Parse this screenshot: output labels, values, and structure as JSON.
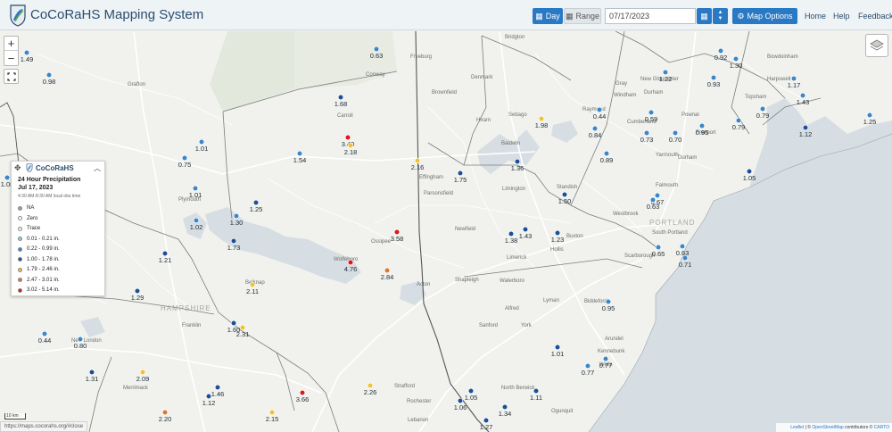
{
  "header": {
    "title": "CoCoRaHS Mapping System",
    "day_label": "Day",
    "range_label": "Range",
    "date_value": "07/17/2023",
    "map_options_label": "Map Options",
    "nav": [
      "Home",
      "Help",
      "Feedback"
    ]
  },
  "legend": {
    "brand": "CoCoRaHS",
    "title": "24 Hour Precipitation",
    "date": "Jul 17, 2023",
    "time_note": "4:30 AM-8:30 AM local obs time",
    "items": [
      {
        "label": "NA",
        "color": "#9aa0a6"
      },
      {
        "label": "Zero",
        "color": "#ffffff"
      },
      {
        "label": "Trace",
        "color": "#f5f5f5"
      },
      {
        "label": "0.01 - 0.21 in.",
        "color": "#8ecae6"
      },
      {
        "label": "0.22 - 0.99 in.",
        "color": "#3a86c8"
      },
      {
        "label": "1.00 - 1.78 in.",
        "color": "#1c4f96"
      },
      {
        "label": "1.79 - 2.46 in.",
        "color": "#f2c12e"
      },
      {
        "label": "2.47 - 3.01 in.",
        "color": "#e0762a"
      },
      {
        "label": "3.02 - 5.14 in.",
        "color": "#d7191c"
      }
    ]
  },
  "scale": "10 km",
  "url": "https://maps.cocorahs.org/#close",
  "attribution": {
    "leaflet": "Leaflet",
    "osm": "OpenStreetMap",
    "contrib": "contributors",
    "carto": "CARTO"
  },
  "state_labels": [
    "HAMPSHIRE",
    "PORTLAND"
  ],
  "places": [
    "Grafton",
    "Plymouth",
    "Carroll",
    "Conway",
    "Fryeburg",
    "Bridgton",
    "Denmark",
    "Brownfield",
    "Hiram",
    "Sebago",
    "Baldwin",
    "Limington",
    "Standish",
    "Windham",
    "Raymond",
    "Cumberland",
    "Yarmouth",
    "Falmouth",
    "Freeport",
    "New Gloucester",
    "Durham",
    "Pownal",
    "Gray",
    "Westbrook",
    "Scarborough",
    "Buxton",
    "Hollis",
    "Waterboro",
    "Newfield",
    "Parsonsfield",
    "Effingham",
    "Ossipee",
    "Wolfeboro",
    "Belknap",
    "Franklin",
    "Merrimack",
    "New London",
    "Acton",
    "Shapleigh",
    "Sanford",
    "Alfred",
    "Lyman",
    "York",
    "Biddeford",
    "Kennebunk",
    "Wells",
    "North Berwick",
    "Rochester",
    "Strafford",
    "Ogunquit",
    "Arundel",
    "Lebanon",
    "Harpswell",
    "Bowdoinham",
    "Topsham",
    "South Portland",
    "Durham",
    "Limerick"
  ],
  "stations": [
    {
      "v": "1.49",
      "c": "1"
    },
    {
      "v": "0.98",
      "c": "1"
    },
    {
      "v": "0.63",
      "c": "1"
    },
    {
      "v": "0.92",
      "c": "1"
    },
    {
      "v": "1.30",
      "c": "1"
    },
    {
      "v": "0.93",
      "c": "1"
    },
    {
      "v": "1.22",
      "c": "1"
    },
    {
      "v": "1.17",
      "c": "1"
    },
    {
      "v": "1.43",
      "c": "1"
    },
    {
      "v": "1.25",
      "c": "1"
    },
    {
      "v": "1.68",
      "c": "2"
    },
    {
      "v": "0.44",
      "c": "1"
    },
    {
      "v": "0.59",
      "c": "1"
    },
    {
      "v": "0.79",
      "c": "1"
    },
    {
      "v": "0.95",
      "c": "1"
    },
    {
      "v": "0.79",
      "c": "1"
    },
    {
      "v": "1.12",
      "c": "2"
    },
    {
      "v": "1.98",
      "c": "3"
    },
    {
      "v": "0.84",
      "c": "1"
    },
    {
      "v": "0.73",
      "c": "1"
    },
    {
      "v": "0.70",
      "c": "1"
    },
    {
      "v": "1.01",
      "c": "1"
    },
    {
      "v": "3.40",
      "c": "5"
    },
    {
      "v": "2.18",
      "c": "3"
    },
    {
      "v": "1.54",
      "c": "1"
    },
    {
      "v": "2.16",
      "c": "3"
    },
    {
      "v": "1.36",
      "c": "2"
    },
    {
      "v": "0.89",
      "c": "1"
    },
    {
      "v": "0.75",
      "c": "1"
    },
    {
      "v": "1.75",
      "c": "2"
    },
    {
      "v": "1.05",
      "c": "2"
    },
    {
      "v": "1.01",
      "c": "1"
    },
    {
      "v": "1.50",
      "c": "2"
    },
    {
      "v": "0.67",
      "c": "1"
    },
    {
      "v": "0.63",
      "c": "1"
    },
    {
      "v": "1.25",
      "c": "2"
    },
    {
      "v": "1.30",
      "c": "1"
    },
    {
      "v": "1.02",
      "c": "1"
    },
    {
      "v": "3.58",
      "c": "5"
    },
    {
      "v": "1.43",
      "c": "2"
    },
    {
      "v": "1.38",
      "c": "2"
    },
    {
      "v": "1.23",
      "c": "2"
    },
    {
      "v": "1.73",
      "c": "2"
    },
    {
      "v": "0.65",
      "c": "1"
    },
    {
      "v": "0.63",
      "c": "1"
    },
    {
      "v": "1.21",
      "c": "2"
    },
    {
      "v": "4.76",
      "c": "5"
    },
    {
      "v": "2.84",
      "c": "4"
    },
    {
      "v": "0.71",
      "c": "1"
    },
    {
      "v": "2.11",
      "c": "3"
    },
    {
      "v": "1.29",
      "c": "2"
    },
    {
      "v": "0.95",
      "c": "1"
    },
    {
      "v": "1.60",
      "c": "2"
    },
    {
      "v": "2.31",
      "c": "3"
    },
    {
      "v": "0.44",
      "c": "1"
    },
    {
      "v": "0.80",
      "c": "1"
    },
    {
      "v": "1.01",
      "c": "2"
    },
    {
      "v": "0.77",
      "c": "1"
    },
    {
      "v": "0.77",
      "c": "1"
    },
    {
      "v": "1.31",
      "c": "2"
    },
    {
      "v": "2.09",
      "c": "3"
    },
    {
      "v": "1.46",
      "c": "2"
    },
    {
      "v": "1.12",
      "c": "2"
    },
    {
      "v": "3.66",
      "c": "5"
    },
    {
      "v": "2.26",
      "c": "3"
    },
    {
      "v": "1.05",
      "c": "2"
    },
    {
      "v": "1.11",
      "c": "2"
    },
    {
      "v": "1.06",
      "c": "2"
    },
    {
      "v": "1.34",
      "c": "2"
    },
    {
      "v": "2.20",
      "c": "4"
    },
    {
      "v": "2.15",
      "c": "3"
    },
    {
      "v": "1.27",
      "c": "2"
    },
    {
      "v": "1.08",
      "c": "1"
    }
  ],
  "colors": {
    "1": "#3a86c8",
    "2": "#1c4f96",
    "3": "#f2c12e",
    "4": "#e0762a",
    "5": "#d7191c"
  }
}
